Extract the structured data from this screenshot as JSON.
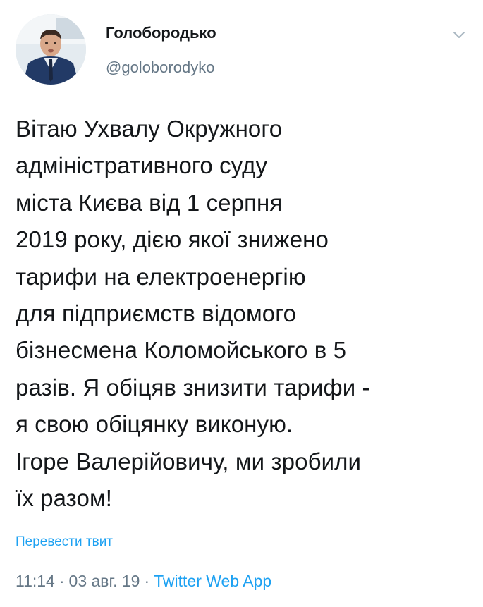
{
  "author": {
    "name": "Голобородько",
    "handle": "@goloborodyko"
  },
  "tweet": {
    "lines": [
      "Вітаю Ухвалу Окружного",
      "адміністративного суду",
      "міста Києва від 1 серпня",
      "2019 року, дією якої знижено",
      "тарифи на електроенергію",
      "для підприємств відомого",
      "бізнесмена Коломойського в 5",
      "разів. Я обіцяв знизити тарифи -",
      "я свою обіцянку виконую.",
      "Ігоре Валерійовичу, ми зробили",
      "їх разом!"
    ],
    "translate_label": "Перевести твит",
    "time": "11:14",
    "date": "03 авг. 19",
    "separator": "·",
    "source": "Twitter Web App"
  },
  "icons": {
    "menu": "chevron-down-icon"
  },
  "colors": {
    "link": "#1da1f2",
    "secondary_text": "#657786",
    "primary_text": "#14171a"
  }
}
